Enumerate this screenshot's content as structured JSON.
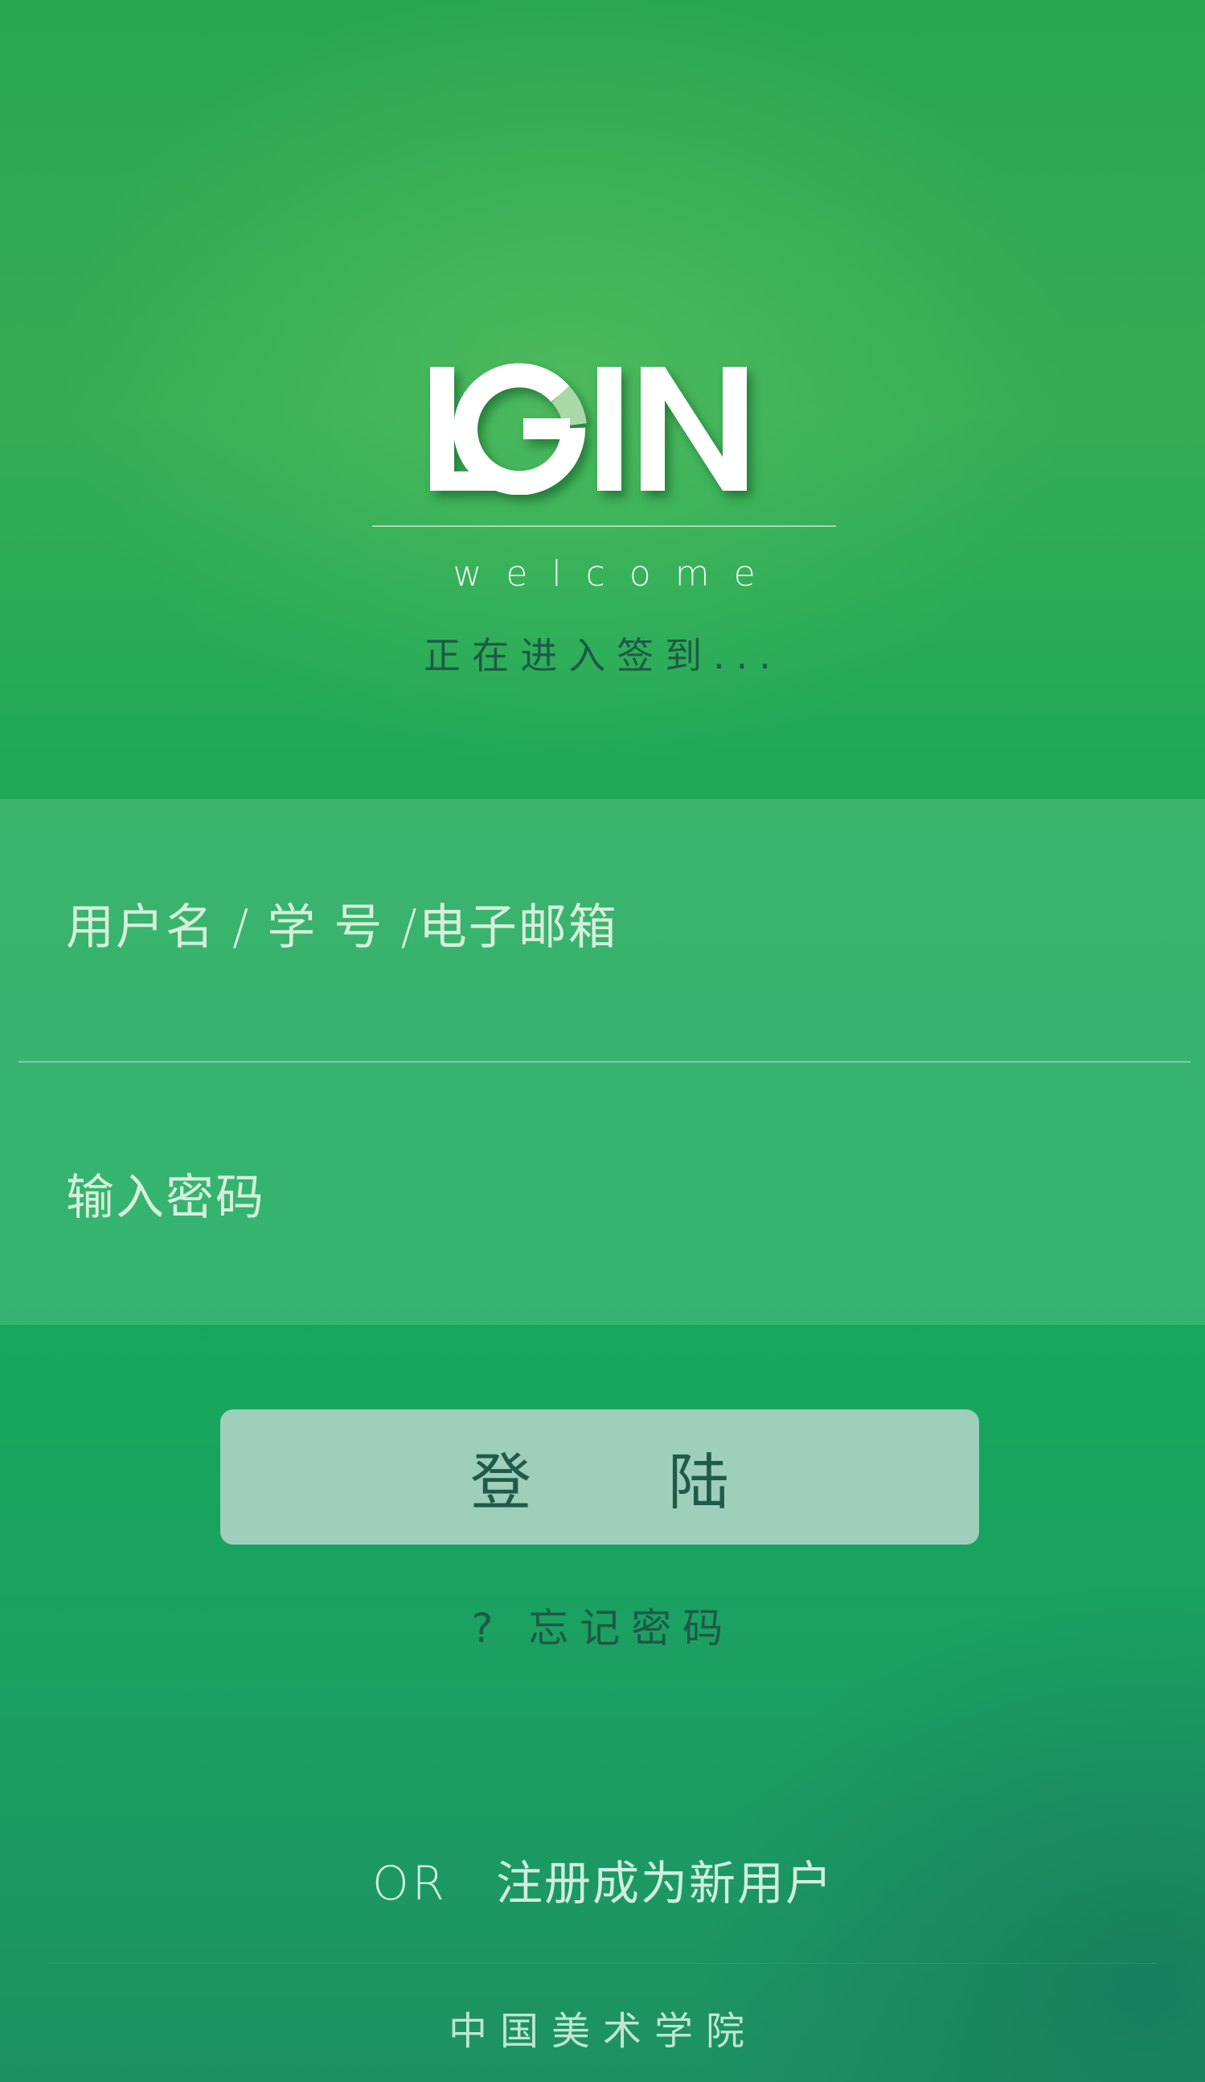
{
  "header": {
    "logo_text": "LGIN",
    "welcome": "welcome",
    "status": "正在进入签到..."
  },
  "form": {
    "username_placeholder": "用户名 / 学 号 /电子邮箱",
    "password_placeholder": "输入密码"
  },
  "actions": {
    "login_label": "登陆",
    "forgot_password": "? 忘记密码",
    "or_label": "OR",
    "register_label": "注册成为新用户"
  },
  "footer": {
    "school_name": "中国美术学院"
  },
  "colors": {
    "background": "#1fa757",
    "login_button": "#9dcfba",
    "dark_text": "#1e5a45",
    "light_text": "#d6efd9"
  }
}
